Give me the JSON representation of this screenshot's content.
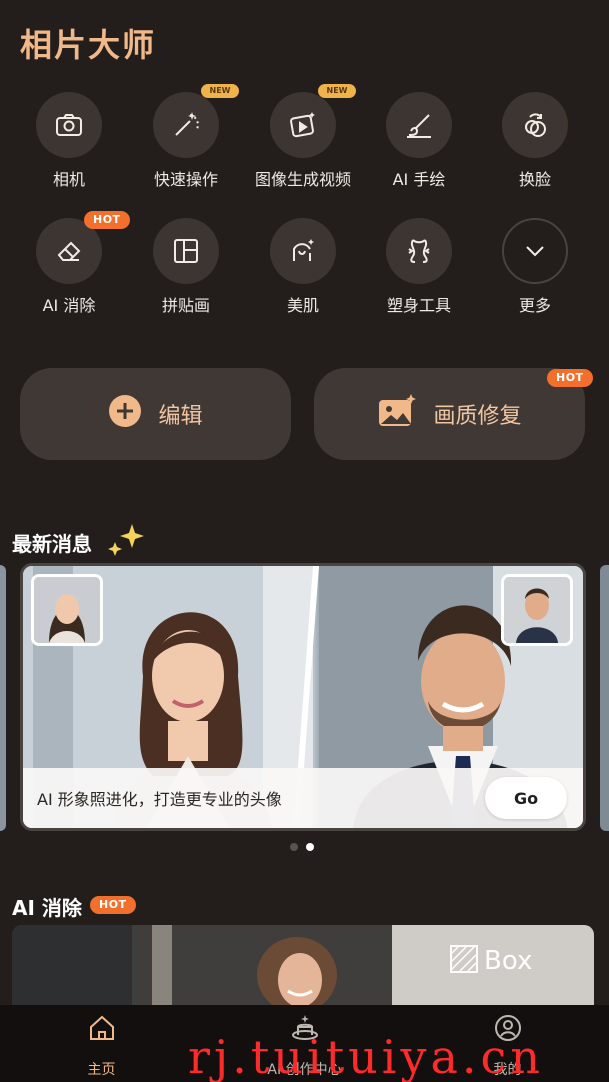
{
  "app": {
    "title": "相片大师"
  },
  "tools": [
    {
      "label": "相机",
      "icon": "camera-icon",
      "badge": ""
    },
    {
      "label": "快速操作",
      "icon": "magic-wand-icon",
      "badge": "NEW"
    },
    {
      "label": "图像生成视频",
      "icon": "image-to-video-icon",
      "badge": "NEW"
    },
    {
      "label": "AI 手绘",
      "icon": "brush-icon",
      "badge": ""
    },
    {
      "label": "换脸",
      "icon": "face-swap-icon",
      "badge": ""
    },
    {
      "label": "AI 消除",
      "icon": "eraser-icon",
      "badge": "HOT"
    },
    {
      "label": "拼贴画",
      "icon": "collage-icon",
      "badge": ""
    },
    {
      "label": "美肌",
      "icon": "beauty-skin-icon",
      "badge": ""
    },
    {
      "label": "塑身工具",
      "icon": "body-shape-icon",
      "badge": ""
    },
    {
      "label": "更多",
      "icon": "chevron-down-icon",
      "badge": ""
    }
  ],
  "actions": {
    "edit_label": "编辑",
    "enhance_label": "画质修复",
    "enhance_badge": "HOT"
  },
  "news": {
    "title": "最新消息",
    "banner_text": "AI 形象照进化，打造更专业的头像",
    "go_label": "Go",
    "page_count": 2,
    "active_page": 2
  },
  "ai_erase": {
    "title": "AI 消除",
    "badge": "HOT",
    "box_label": "Box"
  },
  "nav": [
    {
      "label": "主页",
      "icon": "home-icon",
      "active": true
    },
    {
      "label": "AI 创作中心",
      "icon": "magic-hat-icon",
      "active": false
    },
    {
      "label": "我的",
      "icon": "profile-icon",
      "active": false
    }
  ],
  "watermark": "rj.tuituiya.cn",
  "colors": {
    "accent": "#f1b98a",
    "hot": "#f2702c",
    "background": "#231e1b"
  }
}
